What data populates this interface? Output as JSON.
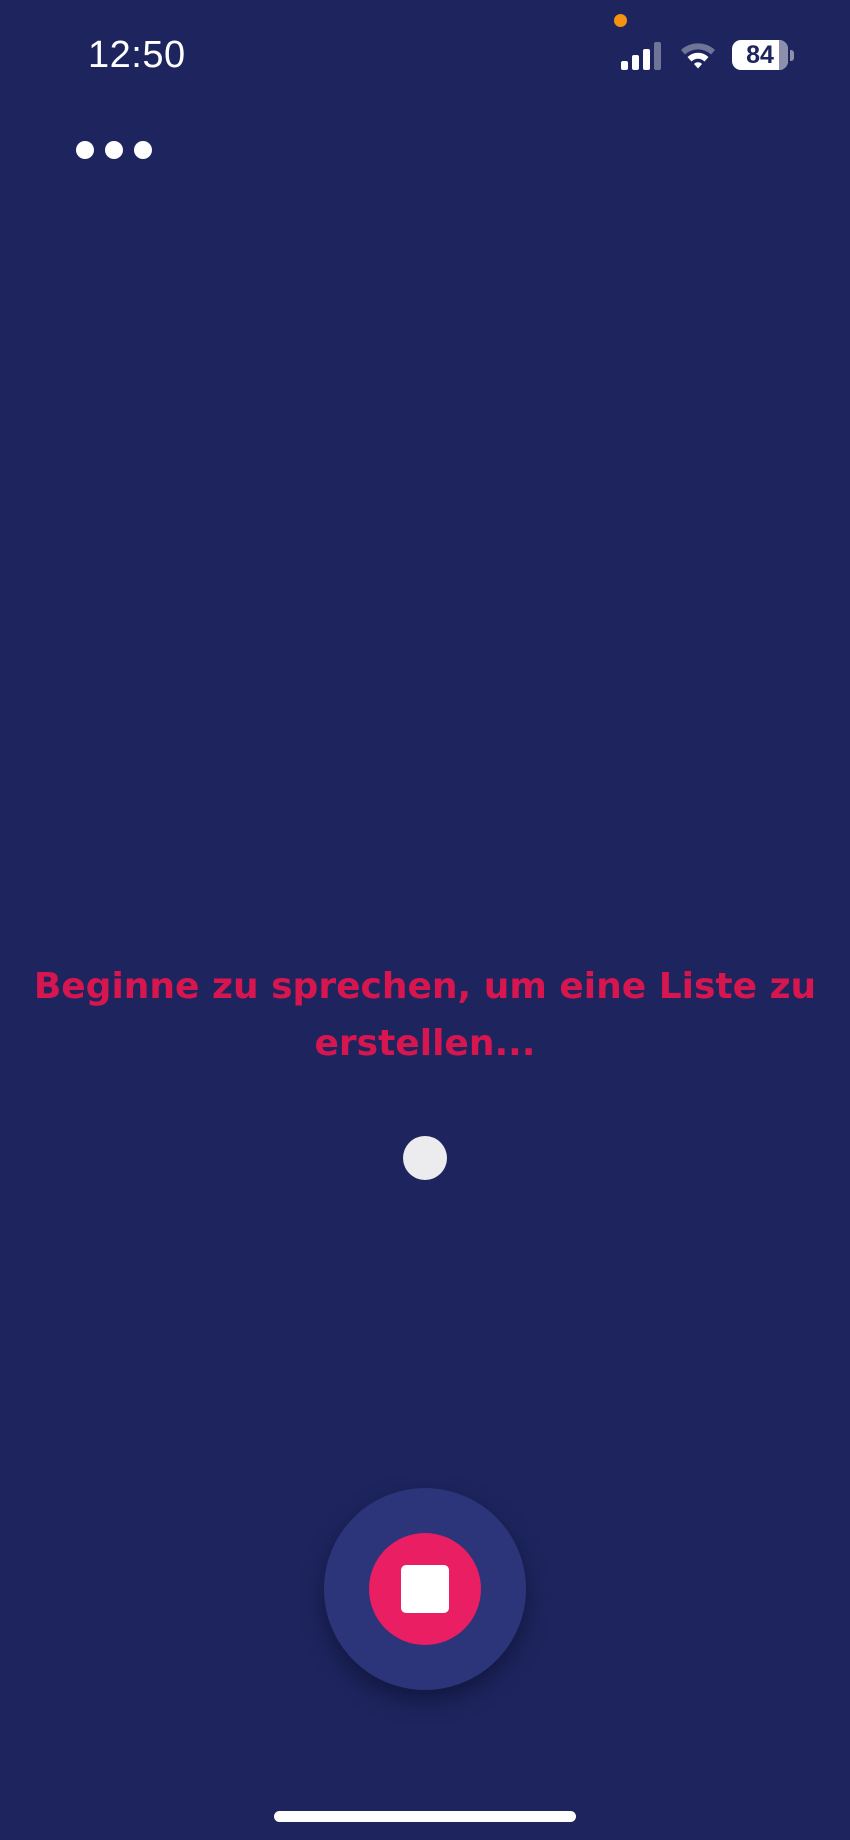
{
  "status_bar": {
    "time": "12:50",
    "battery_level": "84",
    "battery_fraction": 0.84,
    "privacy_indicator_color": "#f2940f",
    "icons": [
      "cellular-signal-icon",
      "wifi-icon",
      "battery-icon"
    ]
  },
  "toolbar": {
    "more_icon": "more-horizontal-icon"
  },
  "main": {
    "prompt": "Beginne zu sprechen, um eine Liste zu erstellen..."
  },
  "controls": {
    "record_icon": "stop-icon",
    "record_button_color": "#ea1e63",
    "record_ring_color": "#2c3579"
  },
  "theme": {
    "background": "#1e255e",
    "accent": "#d7164f"
  }
}
